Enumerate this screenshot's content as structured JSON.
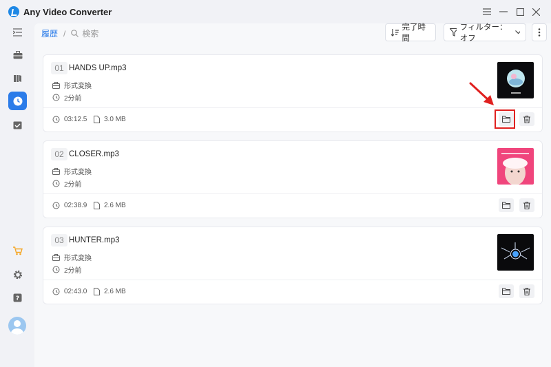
{
  "app": {
    "title": "Any Video Converter"
  },
  "breadcrumb": {
    "history": "履歴",
    "separator": "/",
    "search": "検索"
  },
  "toolbar": {
    "sort_label": "完了時間",
    "filter_label": "フィルター：オフ"
  },
  "items": [
    {
      "index": "01",
      "name": "HANDS UP.mp3",
      "task": "形式変換",
      "time_ago": "2分前",
      "duration": "03:12.5",
      "size": "3.0 MB"
    },
    {
      "index": "02",
      "name": "CLOSER.mp3",
      "task": "形式変換",
      "time_ago": "2分前",
      "duration": "02:38.9",
      "size": "2.6 MB"
    },
    {
      "index": "03",
      "name": "HUNTER.mp3",
      "task": "形式変換",
      "time_ago": "2分前",
      "duration": "02:43.0",
      "size": "2.6 MB"
    }
  ],
  "colors": {
    "accent": "#2b7ce9",
    "highlight": "#e0201f",
    "cart": "#f5a623"
  }
}
